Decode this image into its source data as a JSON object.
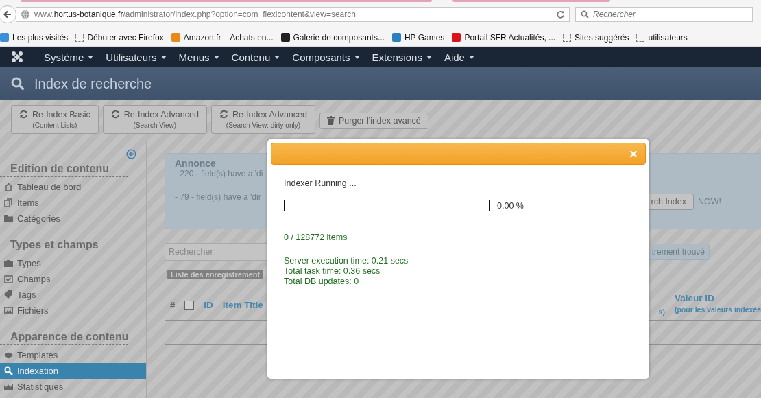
{
  "browser": {
    "url": {
      "prefix": "www.",
      "host": "hortus-botanique.fr",
      "path": "/administrator/index.php?option=com_flexicontent&view=search"
    },
    "search": {
      "placeholder": "Rechercher"
    }
  },
  "bookmarks": [
    {
      "label": "Les plus visités",
      "kind": "logo",
      "color": "#3b8fd8"
    },
    {
      "label": "Débuter avec Firefox",
      "kind": "blank"
    },
    {
      "label": "Amazon.fr – Achats en...",
      "kind": "logo",
      "color": "#e8891a"
    },
    {
      "label": "Galerie de composants...",
      "kind": "logo",
      "color": "#222222"
    },
    {
      "label": "HP Games",
      "kind": "logo",
      "color": "#2a7fc0"
    },
    {
      "label": "Portail SFR Actualités, ...",
      "kind": "logo",
      "color": "#d8141e"
    },
    {
      "label": "Sites suggérés",
      "kind": "blank"
    },
    {
      "label": "utilisateurs",
      "kind": "blank"
    }
  ],
  "menu": [
    "Système",
    "Utilisateurs",
    "Menus",
    "Contenu",
    "Composants",
    "Extensions",
    "Aide"
  ],
  "page_title": "Index de recherche",
  "toolbar": [
    {
      "label": "Re-Index Basic",
      "sublabel": "(Content Lists)",
      "kind": "refresh"
    },
    {
      "label": "Re-Index Advanced",
      "sublabel": "(Search View)",
      "kind": "refresh"
    },
    {
      "label": "Re-Index Advanced",
      "sublabel": "(Search View: dirty only)",
      "kind": "refresh"
    },
    {
      "label": "Purger l'index avancé",
      "kind": "trash"
    }
  ],
  "sidebar": [
    {
      "heading": "Edition de contenu",
      "items": [
        {
          "label": "Tableau de bord",
          "selected": false
        },
        {
          "label": "Items",
          "selected": false
        },
        {
          "label": "Catégories",
          "selected": false
        }
      ]
    },
    {
      "heading": "Types et champs",
      "items": [
        {
          "label": "Types",
          "selected": false
        },
        {
          "label": "Champs",
          "selected": false
        },
        {
          "label": "Tags",
          "selected": false
        },
        {
          "label": "Fichiers",
          "selected": false
        }
      ]
    },
    {
      "heading": "Apparence de contenu",
      "items": [
        {
          "label": "Templates",
          "selected": false
        },
        {
          "label": "Indexation",
          "selected": true
        },
        {
          "label": "Statistiques",
          "selected": false
        }
      ]
    }
  ],
  "notice": {
    "title": "Annonce",
    "lines": [
      "- 220 - field(s) have a 'di",
      "- 79 - field(s) have a 'dir"
    ],
    "button": "rch Index",
    "note": "NOW!"
  },
  "filter": {
    "placeholder": "Rechercher",
    "found_badge": "trement trouvé",
    "list_badge": "Liste des enregistrement"
  },
  "table": {
    "columns_left": [
      "#",
      "ID",
      "Item Title"
    ],
    "select_all": {
      "checked": false
    },
    "column_cut": "s)",
    "column_right": {
      "title": "Valeur ID",
      "subtitle": "(pour les valeurs indexée"
    }
  },
  "modal": {
    "status": "Indexer Running ...",
    "close": "×",
    "progress": {
      "level": 0,
      "reading": "0.00 %"
    },
    "count": "0 / 128772 items",
    "stats": [
      "Server execution time: 0.21 secs",
      "Total task time: 0.36 secs",
      "Total DB updates: 0"
    ]
  }
}
